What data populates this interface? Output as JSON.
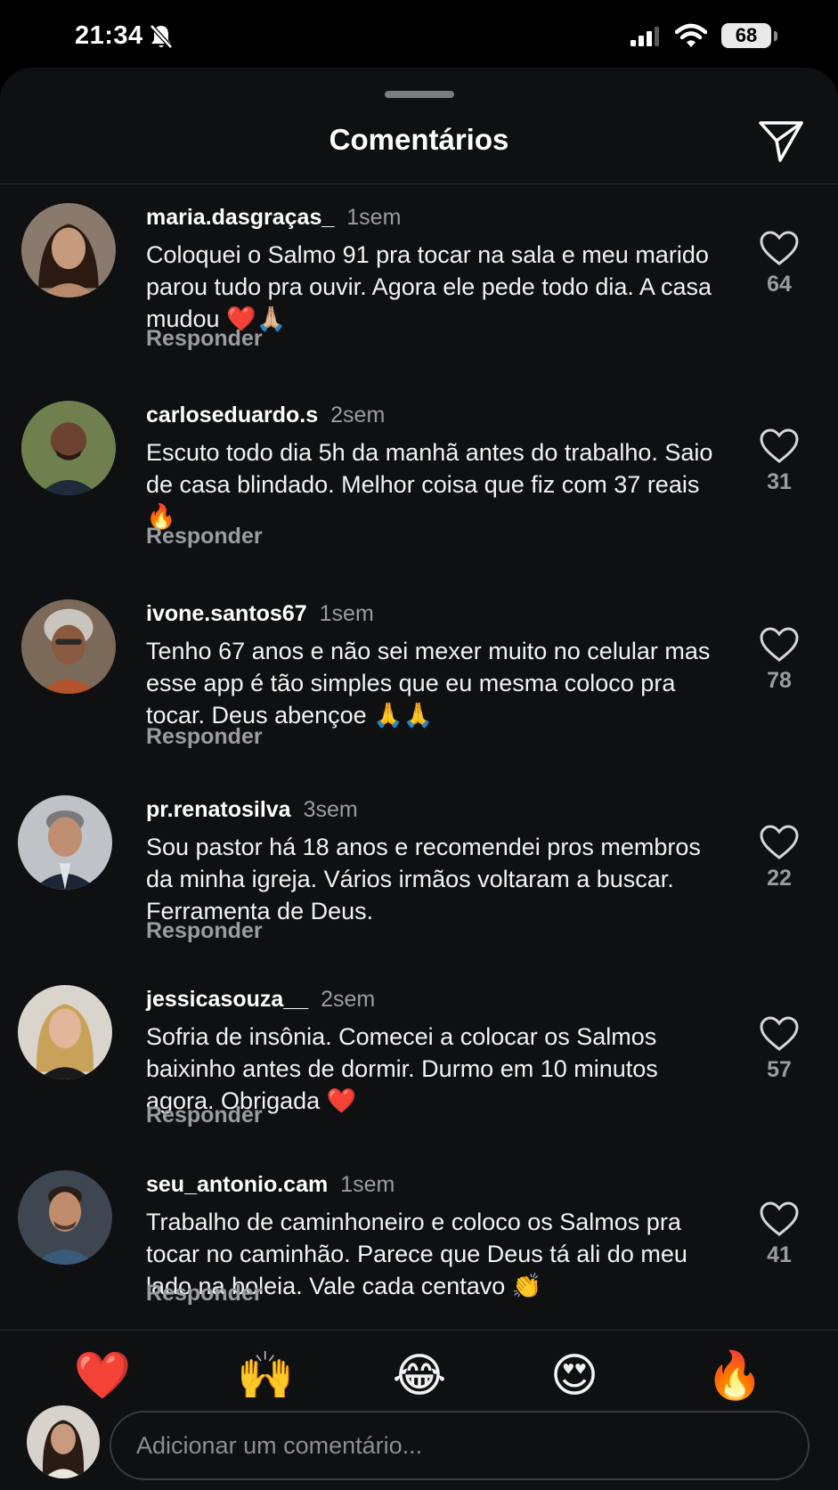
{
  "status_bar": {
    "time": "21:34",
    "battery": "68"
  },
  "header": {
    "title": "Comentários"
  },
  "comments": [
    {
      "username": "maria.dasgraças_",
      "time": "1sem",
      "text": "Coloquei o Salmo 91 pra tocar na sala e meu marido parou tudo pra ouvir. Agora ele pede todo dia. A casa mudou ❤️🙏🏼",
      "reply": "Responder",
      "likes": "64"
    },
    {
      "username": "carloseduardo.s",
      "time": "2sem",
      "text": "Escuto todo dia 5h da manhã antes do trabalho. Saio de casa blindado. Melhor coisa que fiz com 37 reais 🔥",
      "reply": "Responder",
      "likes": "31"
    },
    {
      "username": "ivone.santos67",
      "time": "1sem",
      "text": "Tenho 67 anos e não sei mexer muito no celular mas esse app é tão simples que eu mesma coloco pra tocar. Deus abençoe 🙏🙏",
      "reply": "Responder",
      "likes": "78"
    },
    {
      "username": "pr.renatosilva",
      "time": "3sem",
      "text": "Sou pastor há 18 anos e recomendei pros membros da minha igreja. Vários irmãos voltaram a buscar. Ferramenta de Deus.",
      "reply": "Responder",
      "likes": "22"
    },
    {
      "username": "jessicasouza__",
      "time": "2sem",
      "text": "Sofria de insônia. Comecei a colocar os Salmos baixinho antes de dormir. Durmo em 10 minutos agora. Obrigada ❤️",
      "reply": "Responder",
      "likes": "57"
    },
    {
      "username": "seu_antonio.cam",
      "time": "1sem",
      "text": "Trabalho de caminhoneiro e coloco os Salmos pra tocar no caminhão. Parece que Deus tá ali do meu lado na boleia. Vale cada centavo 👏",
      "reply": "Responder",
      "likes": "41"
    }
  ],
  "reactions": [
    "❤️",
    "🙌",
    "😂",
    "😍",
    "🔥"
  ],
  "composer": {
    "placeholder": "Adicionar um comentário..."
  },
  "colors": {
    "background": "#0f1012",
    "text": "#f2f2f2",
    "muted": "#9b9ca1",
    "divider": "#2a2b2e"
  },
  "icons": {
    "header": "send-icon",
    "comment": "heart-icon",
    "status": [
      "bell-off-icon",
      "signal-icon",
      "wifi-icon",
      "battery-icon"
    ]
  }
}
